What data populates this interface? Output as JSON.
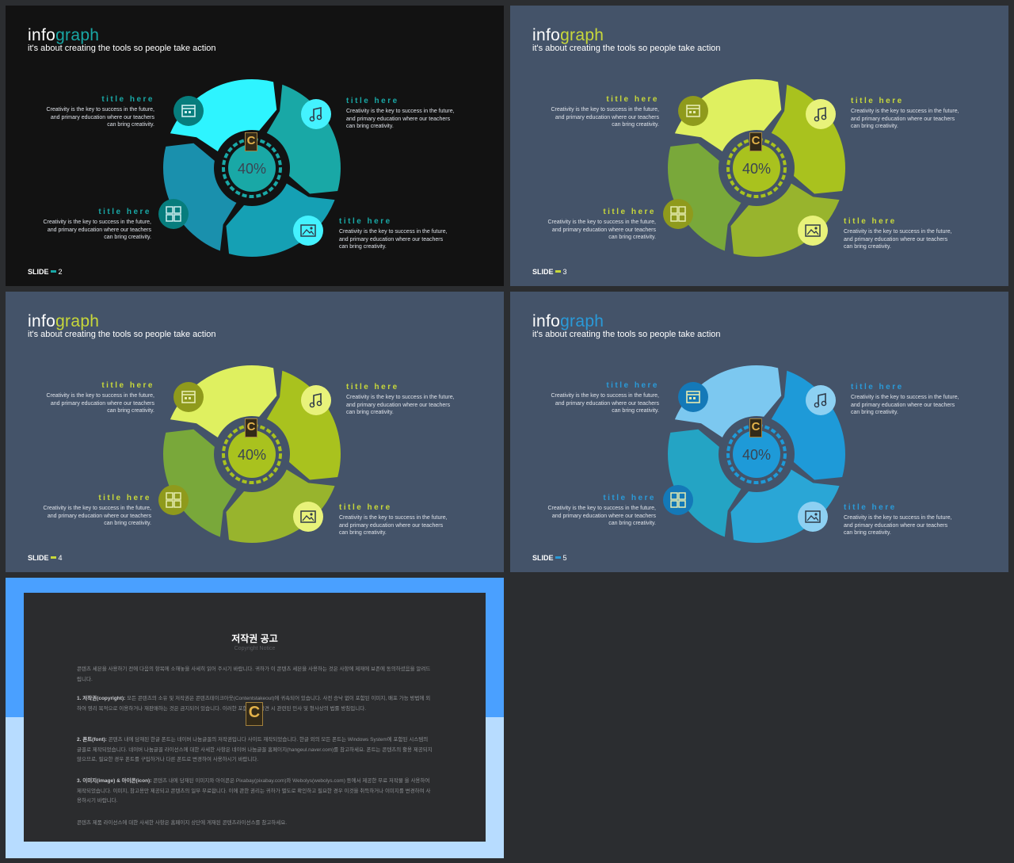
{
  "slides": [
    {
      "title_prefix": "info",
      "title_accent": "graph",
      "subtitle": "it's about creating the tools so people take action",
      "slide_label": "SLIDE",
      "slide_number": "2",
      "center_value": "40%",
      "colors": {
        "background": "#121212",
        "accent": "#19a8a6",
        "segments": [
          "#2ef4ff",
          "#19a8a6",
          "#15a0b4",
          "#1a90ad"
        ],
        "icon_fill": "#44f2ff",
        "icon_fill_dark": "#077d7d"
      },
      "blocks": [
        {
          "heading": "title here",
          "body": "Creativity is the key to success in the future,\nand primary education where our teachers\ncan bring creativity."
        },
        {
          "heading": "title here",
          "body": "Creativity is the key to success in the future,\nand primary education where our teachers\ncan bring creativity."
        },
        {
          "heading": "title here",
          "body": "Creativity is the key to success in the future,\nand primary education where our teachers\ncan bring creativity."
        },
        {
          "heading": "title here",
          "body": "Creativity is the key to success in the future,\nand primary education where our teachers\ncan bring creativity."
        }
      ],
      "icons": [
        "calendar-icon",
        "music-note-icon",
        "grid-icon",
        "image-icon"
      ]
    },
    {
      "title_prefix": "info",
      "title_accent": "graph",
      "subtitle": "it's about creating the tools so people take action",
      "slide_label": "SLIDE",
      "slide_number": "3",
      "center_value": "40%",
      "colors": {
        "background": "#445369",
        "accent": "#c8d83a",
        "segments": [
          "#dff060",
          "#a9c21e",
          "#98b42d",
          "#79a83a"
        ],
        "icon_fill": "#e8f27a",
        "icon_fill_dark": "#8f9a1c"
      },
      "blocks": [
        {
          "heading": "title here",
          "body": "Creativity is the key to success in the future,\nand primary education where our teachers\ncan bring creativity."
        },
        {
          "heading": "title here",
          "body": "Creativity is the key to success in the future,\nand primary education where our teachers\ncan bring creativity."
        },
        {
          "heading": "title here",
          "body": "Creativity is the key to success in the future,\nand primary education where our teachers\ncan bring creativity."
        },
        {
          "heading": "title here",
          "body": "Creativity is the key to success in the future,\nand primary education where our teachers\ncan bring creativity."
        }
      ],
      "icons": [
        "calendar-icon",
        "music-note-icon",
        "grid-icon",
        "image-icon"
      ]
    },
    {
      "title_prefix": "info",
      "title_accent": "graph",
      "subtitle": "it's about creating the tools so people take action",
      "slide_label": "SLIDE",
      "slide_number": "4",
      "center_value": "40%",
      "colors": {
        "background": "#445369",
        "accent": "#c8d83a",
        "segments": [
          "#dff060",
          "#a9c21e",
          "#98b42d",
          "#79a83a"
        ],
        "icon_fill": "#e8f27a",
        "icon_fill_dark": "#8f9a1c"
      },
      "blocks": [
        {
          "heading": "title here",
          "body": "Creativity is the key to success in the future,\nand primary education where our teachers\ncan bring creativity."
        },
        {
          "heading": "title here",
          "body": "Creativity is the key to success in the future,\nand primary education where our teachers\ncan bring creativity."
        },
        {
          "heading": "title here",
          "body": "Creativity is the key to success in the future,\nand primary education where our teachers\ncan bring creativity."
        },
        {
          "heading": "title here",
          "body": "Creativity is the key to success in the future,\nand primary education where our teachers\ncan bring creativity."
        }
      ],
      "icons": [
        "calendar-icon",
        "music-note-icon",
        "grid-icon",
        "image-icon"
      ]
    },
    {
      "title_prefix": "info",
      "title_accent": "graph",
      "subtitle": "it's about creating the tools so people take action",
      "slide_label": "SLIDE",
      "slide_number": "5",
      "center_value": "40%",
      "colors": {
        "background": "#445369",
        "accent": "#2a9ad8",
        "segments": [
          "#7cc8f0",
          "#1e9ad8",
          "#2aa6d6",
          "#24a4c4"
        ],
        "icon_fill": "#8dd0f2",
        "icon_fill_dark": "#1479b8"
      },
      "blocks": [
        {
          "heading": "title here",
          "body": "Creativity is the key to success in the future,\nand primary education where our teachers\ncan bring creativity."
        },
        {
          "heading": "title here",
          "body": "Creativity is the key to success in the future,\nand primary education where our teachers\ncan bring creativity."
        },
        {
          "heading": "title here",
          "body": "Creativity is the key to success in the future,\nand primary education where our teachers\ncan bring creativity."
        },
        {
          "heading": "title here",
          "body": "Creativity is the key to success in the future,\nand primary education where our teachers\ncan bring creativity."
        }
      ],
      "icons": [
        "calendar-icon",
        "music-note-icon",
        "grid-icon",
        "image-icon"
      ]
    }
  ],
  "notice": {
    "title": "저작권 공고",
    "subtitle": "Copyright Notice",
    "intro": "콘텐츠 세븐을 사용하기 전에 다음의 항목에 소해놓을 사세히 읽어 주시기 바랍니다. 귀하가 이 콘텐츠 세븐을 사용하는 것은 사항에 제재에 보존에 동의하셨음을 알려드립니다.",
    "section1_label": "1. 저작권(copyright):",
    "section1_text": " 모든 콘텐츠의 소유 및 저작권은 콘텐츠테이크아웃(Contentstakeout)에 귀속되어 있습니다. 사전 승낙 없이 포함된 이미지, 배포 가능 방법에 외하여 영리 목적으로 이용하거나 재판매하는 것은 금지되어 있습니다. 이러한 포함 행위 발견 시 관련된 민사 및 형사상의 법률 방침입니다.",
    "section2_label": "2. 폰트(font):",
    "section2_text": " 콘텐츠 내에 담재된 한글 폰트는 네이버 나눔글꼴의 저작권입니다 사이트 재작되었습니다. 한글 외의 모든 폰트는 Windows System에 포함된 시스템의 글꼴로 제작되었습니다. 네이버 나눔글꼴 라이선스에 대한 사세한 사항은 네이버 나눔글꼴 홈페이지(hangeul.naver.com)를 참고하세요. 폰트는 콘텐츠의 활용 제공되지 않으므로, 필요한 경우 폰트를 구입하거나 다른 폰트로 변경하여 사용하시기 바랍니다.",
    "section3_label": "3. 이미지(image) & 아이콘(icon):",
    "section3_text": " 콘텐츠 내에 담재된 이미지와 아이콘은 Pixabay(pixabay.com)와 Webolys(webolys.com) 등에서 제공한 무료 저작물 을 사용하여 제작되었습니다. 이미지, 참고용만 제공되고 콘텐츠의 일부 무료합니다. 이에 관한 권리는 귀하가 별도로 확인하고 필요한 경우 이것을 취득하거나 이미지를 변경하여 사용하시기 바랍니다.",
    "closing": "콘텐츠 제품 라이선스에 대한 사세한 사항은 홈페이지 상단에 게재된 콘텐츠라이선스를 참고하세요.",
    "colors": {
      "top_band": "#4aa0ff",
      "bottom_band": "#b7dcff",
      "panel": "#2b2c2e"
    }
  }
}
